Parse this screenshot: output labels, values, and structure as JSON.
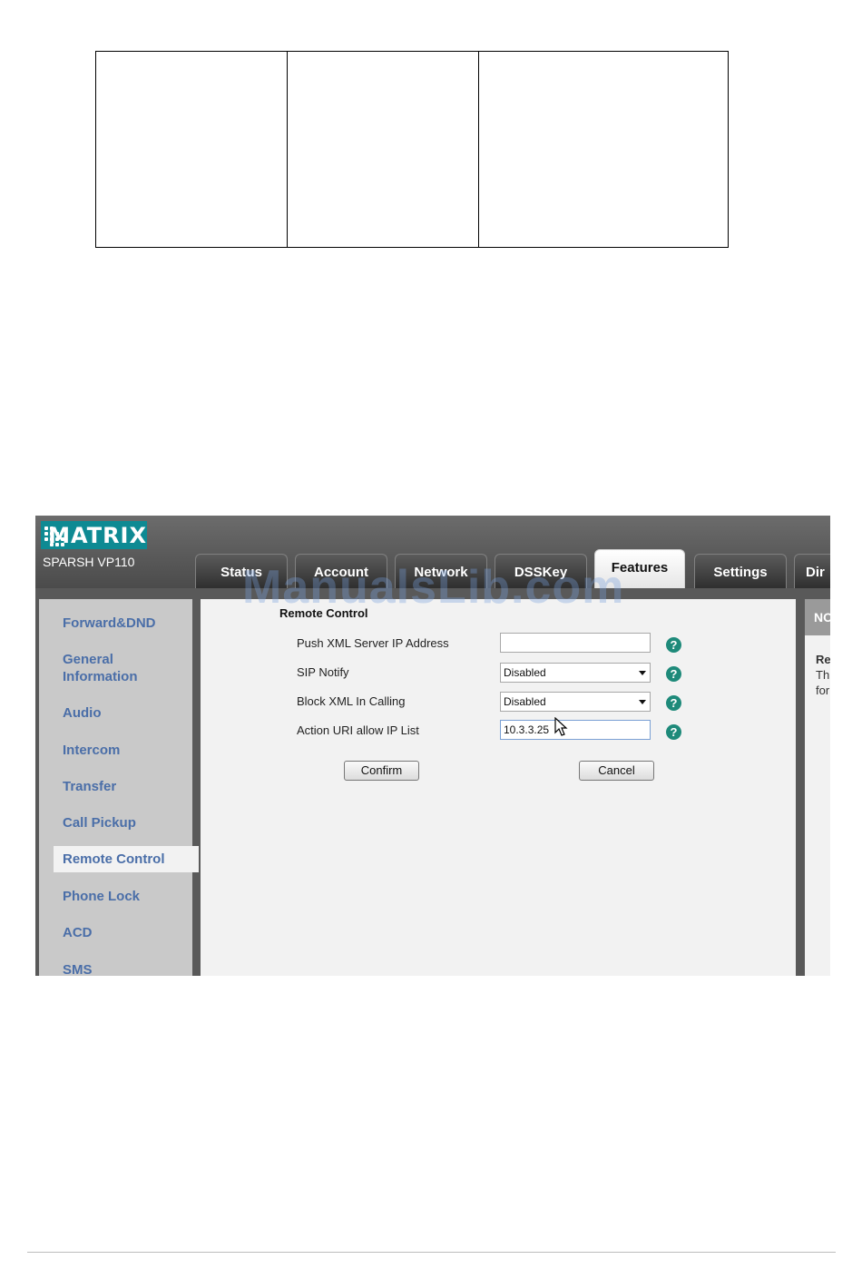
{
  "brand": {
    "logo_text": "MATRIX",
    "model": "SPARSH VP110",
    "accent": "#0e8a93"
  },
  "tabs": [
    {
      "label": "Status",
      "active": false
    },
    {
      "label": "Account",
      "active": false
    },
    {
      "label": "Network",
      "active": false
    },
    {
      "label": "DSSKey",
      "active": false
    },
    {
      "label": "Features",
      "active": true
    },
    {
      "label": "Settings",
      "active": false
    },
    {
      "label": "Dir",
      "active": false
    }
  ],
  "sidebar": {
    "items": [
      {
        "label": "Forward&DND"
      },
      {
        "label": "General Information"
      },
      {
        "label": "Audio"
      },
      {
        "label": "Intercom"
      },
      {
        "label": "Transfer"
      },
      {
        "label": "Call Pickup"
      },
      {
        "label": "Remote Control",
        "active": true
      },
      {
        "label": "Phone Lock"
      },
      {
        "label": "ACD"
      },
      {
        "label": "SMS"
      }
    ]
  },
  "form": {
    "section_title": "Remote Control",
    "rows": [
      {
        "label": "Push XML Server IP Address",
        "type": "text",
        "value": ""
      },
      {
        "label": "SIP Notify",
        "type": "select",
        "value": "Disabled"
      },
      {
        "label": "Block XML In Calling",
        "type": "select",
        "value": "Disabled"
      },
      {
        "label": "Action URI allow IP List",
        "type": "text",
        "value": "10.3.3.25"
      }
    ],
    "confirm_label": "Confirm",
    "cancel_label": "Cancel"
  },
  "right_panel": {
    "header": "NO",
    "line1": "Re",
    "line2": "Th",
    "line3": "for"
  },
  "watermark": "ManualsLib.com",
  "help_icon": "question-circle-icon",
  "help_color": "#1e8a7a"
}
